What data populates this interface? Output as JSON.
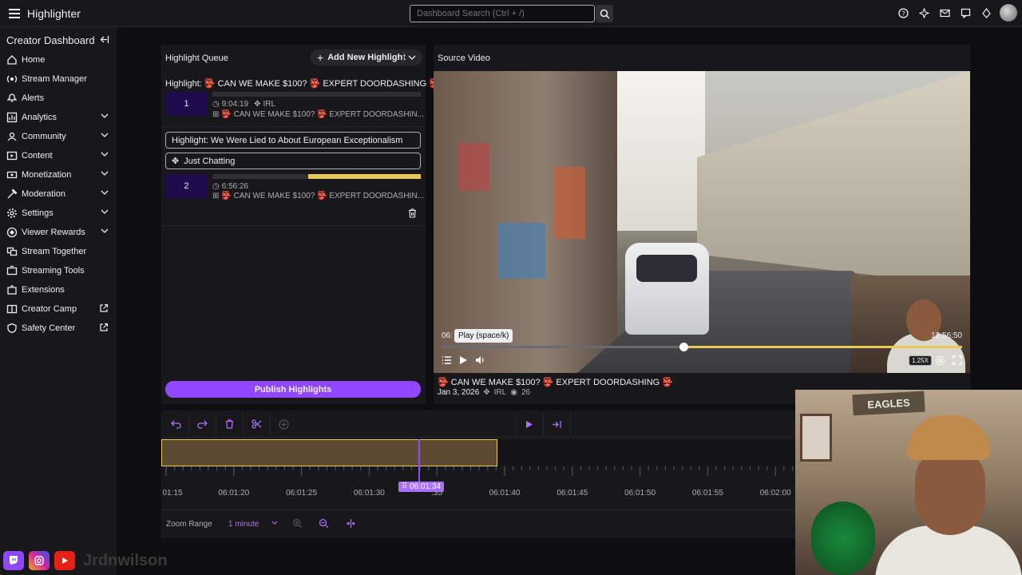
{
  "topbar": {
    "title": "Highlighter",
    "search_placeholder": "Dashboard Search (Ctrl + /)"
  },
  "sidebar": {
    "heading": "Creator Dashboard",
    "items": [
      {
        "label": "Home",
        "icon": "home-icon",
        "chevron": false,
        "external": false
      },
      {
        "label": "Stream Manager",
        "icon": "stream-manager-icon",
        "chevron": false,
        "external": false
      },
      {
        "label": "Alerts",
        "icon": "alerts-icon",
        "chevron": false,
        "external": false
      },
      {
        "label": "Analytics",
        "icon": "analytics-icon",
        "chevron": true,
        "external": false
      },
      {
        "label": "Community",
        "icon": "community-icon",
        "chevron": true,
        "external": false
      },
      {
        "label": "Content",
        "icon": "content-icon",
        "chevron": true,
        "external": false
      },
      {
        "label": "Monetization",
        "icon": "monetization-icon",
        "chevron": true,
        "external": false
      },
      {
        "label": "Moderation",
        "icon": "moderation-icon",
        "chevron": true,
        "external": false
      },
      {
        "label": "Settings",
        "icon": "settings-icon",
        "chevron": true,
        "external": false
      },
      {
        "label": "Viewer Rewards",
        "icon": "viewer-rewards-icon",
        "chevron": true,
        "external": false
      },
      {
        "label": "Stream Together",
        "icon": "stream-together-icon",
        "chevron": false,
        "external": false
      },
      {
        "label": "Streaming Tools",
        "icon": "streaming-tools-icon",
        "chevron": false,
        "external": false
      },
      {
        "label": "Extensions",
        "icon": "extensions-icon",
        "chevron": false,
        "external": false
      },
      {
        "label": "Creator Camp",
        "icon": "creator-camp-icon",
        "chevron": false,
        "external": true
      },
      {
        "label": "Safety Center",
        "icon": "safety-center-icon",
        "chevron": false,
        "external": true
      }
    ]
  },
  "queue": {
    "title": "Highlight Queue",
    "add_label": "Add New Highlight",
    "highlight1": {
      "title": "Highlight: 👺 CAN WE MAKE $100? 👺 EXPERT DOORDASHING 👺",
      "number": "1",
      "duration": "9:04:19",
      "category": "IRL",
      "source": "👺 CAN WE MAKE $100? 👺 EXPERT DOORDASHIN..."
    },
    "highlight2": {
      "title_field": "Highlight: We Were Lied to About European Exceptionalism",
      "category_field": "Just Chatting",
      "number": "2",
      "duration": "6:56:26",
      "source": "👺 CAN WE MAKE $100? 👺 EXPERT DOORDASHIN..."
    },
    "publish_label": "Publish Highlights"
  },
  "source": {
    "title": "Source Video",
    "time_start": "06:",
    "time_end": "12:56:50",
    "tooltip": "Play (space/k)",
    "speed": "1.25X",
    "progress": 0.46,
    "video_title": "👺 CAN WE MAKE $100? 👺 EXPERT DOORDASHING 👺",
    "date": "Jan 3, 2026",
    "category": "IRL",
    "views": "26"
  },
  "editor": {
    "tick_labels": [
      "01:15",
      "06:01:20",
      "06:01:25",
      "06:01:30",
      ":35",
      "06:01:40",
      "06:01:45",
      "06:01:50",
      "06:01:55",
      "06:02:00"
    ],
    "playhead_label": "06:01:34",
    "zoom_label": "Zoom Range",
    "zoom_value": "1 minute"
  },
  "webcam": {
    "sign": "EAGLES"
  },
  "social": {
    "name": "Jrdnwilson"
  },
  "colors": {
    "accent": "#9147ff",
    "clip": "#e8c85a",
    "background": "#0e0e10",
    "panel": "#18181b"
  }
}
